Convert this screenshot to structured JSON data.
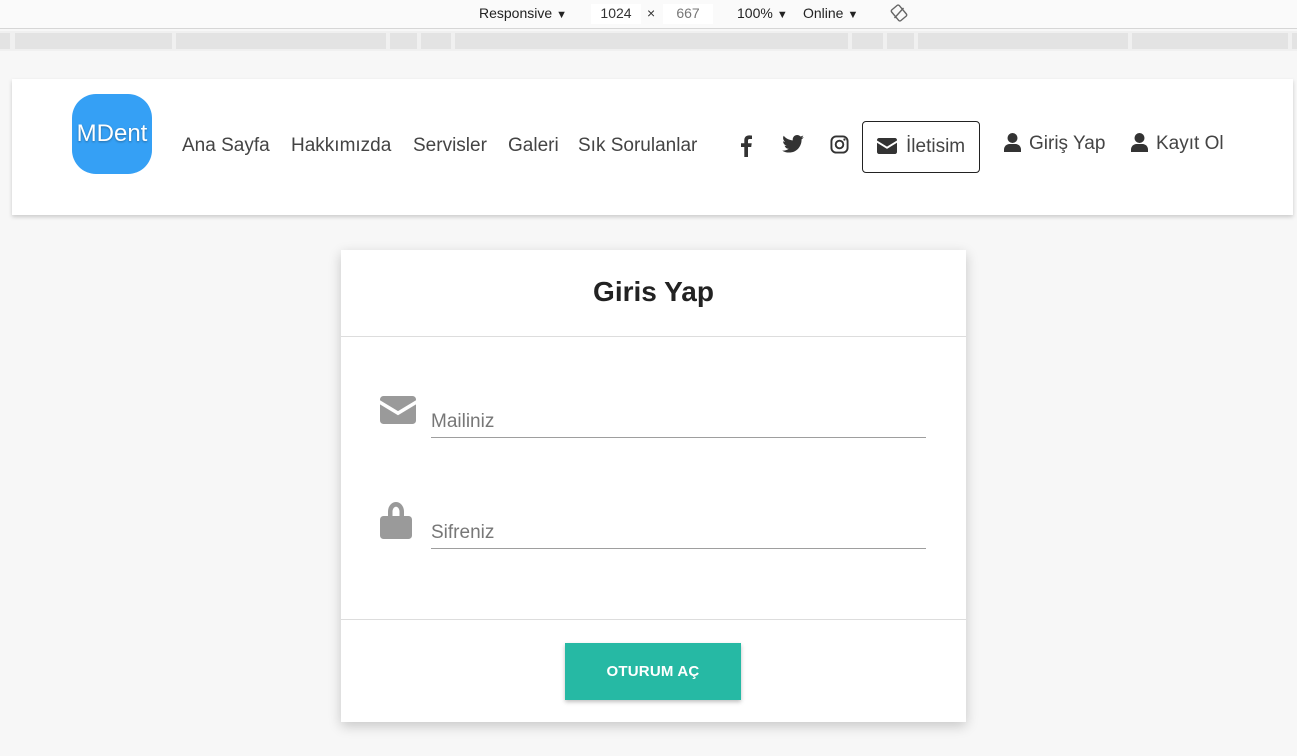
{
  "devtools": {
    "device": "Responsive",
    "width": "1024",
    "times": "×",
    "height": "667",
    "zoom": "100%",
    "network": "Online",
    "caret": "▼"
  },
  "header": {
    "logo_text": "MDent",
    "nav": [
      {
        "label": "Ana Sayfa"
      },
      {
        "label": "Hakkımızda"
      },
      {
        "label": "Servisler"
      },
      {
        "label": "Galeri"
      },
      {
        "label": "Sık Sorulanlar"
      }
    ],
    "social_icons": [
      "facebook-icon",
      "twitter-icon",
      "instagram-icon"
    ],
    "contact_label": "İletisim",
    "login_label": "Giriş Yap",
    "register_label": "Kayıt Ol"
  },
  "login_form": {
    "title": "Giris Yap",
    "email_placeholder": "Mailiniz",
    "password_placeholder": "Sifreniz",
    "submit_label": "OTURUM AÇ",
    "accent_color": "#26b9a4"
  },
  "colors": {
    "logo_bg": "#35a0f5",
    "icon_gray": "#9a9a9a"
  }
}
